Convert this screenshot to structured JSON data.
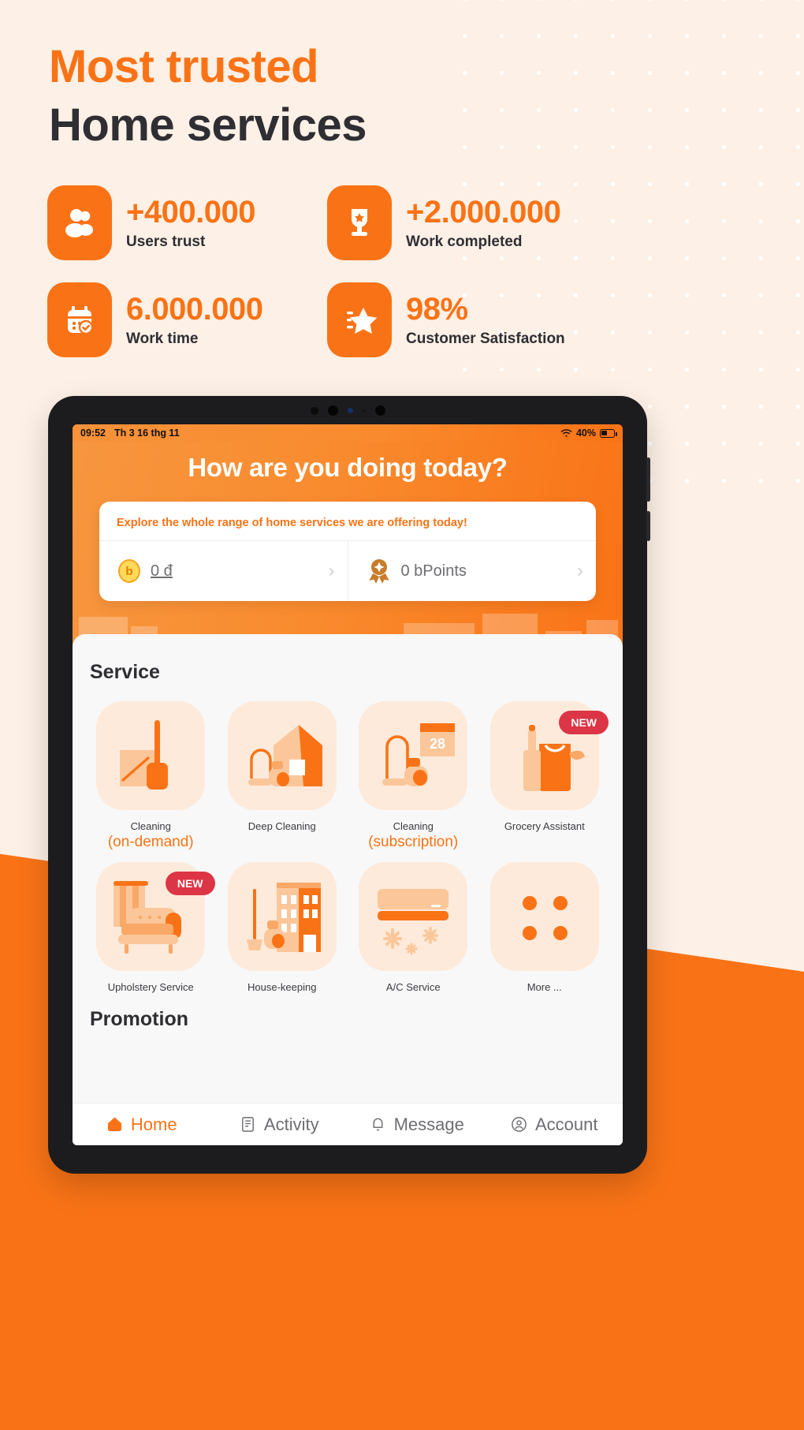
{
  "hero": {
    "title_line1": "Most trusted",
    "title_line2": "Home services"
  },
  "stats": [
    {
      "icon": "users-icon",
      "value": "+400.000",
      "label": "Users trust"
    },
    {
      "icon": "trophy-icon",
      "value": "+2.000.000",
      "label": "Work completed"
    },
    {
      "icon": "calendar-check-icon",
      "value": "6.000.000",
      "label": "Work time"
    },
    {
      "icon": "star-badge-icon",
      "value": "98%",
      "label": "Customer Satisfaction"
    }
  ],
  "device": {
    "statusbar": {
      "time": "09:52",
      "date": "Th 3 16 thg 11",
      "wifi_icon": "wifi-icon",
      "battery": "40%"
    }
  },
  "app": {
    "greeting": "How are you doing today?",
    "promo_note": "Explore the whole range of home services we are offering today!",
    "wallet": {
      "balance_icon": "bcoin-icon",
      "balance": "0 đ",
      "points_icon": "bpoints-medal-icon",
      "points": "0 bPoints",
      "chevron_icon": "chevron-right-icon"
    },
    "service_section_title": "Service",
    "promotion_section_title": "Promotion",
    "services": [
      {
        "label": "Cleaning",
        "sublabel": "(on-demand)",
        "icon": "mop-bucket-icon",
        "badge": ""
      },
      {
        "label": "Deep Cleaning",
        "sublabel": "",
        "icon": "house-vacuum-icon",
        "badge": ""
      },
      {
        "label": "Cleaning",
        "sublabel": "(subscription)",
        "icon": "vacuum-calendar-icon",
        "badge": "",
        "calendar_day": "28"
      },
      {
        "label": "Grocery Assistant",
        "sublabel": "",
        "icon": "grocery-bag-icon",
        "badge": "NEW"
      },
      {
        "label": "Upholstery Service",
        "sublabel": "",
        "icon": "sofa-icon",
        "badge": "NEW"
      },
      {
        "label": "House-keeping",
        "sublabel": "",
        "icon": "building-broom-icon",
        "badge": ""
      },
      {
        "label": "A/C Service",
        "sublabel": "",
        "icon": "air-conditioner-icon",
        "badge": ""
      },
      {
        "label": "More ...",
        "sublabel": "",
        "icon": "more-dots-icon",
        "badge": ""
      }
    ],
    "bottom_nav": [
      {
        "label": "Home",
        "icon": "home-icon",
        "active": true
      },
      {
        "label": "Activity",
        "icon": "activity-icon",
        "active": false
      },
      {
        "label": "Message",
        "icon": "bell-icon",
        "active": false
      },
      {
        "label": "Account",
        "icon": "account-icon",
        "active": false
      }
    ]
  },
  "colors": {
    "brand_orange": "#F97316",
    "cream_bg": "#FDF0E6",
    "tile_bg": "#FDEADB",
    "badge_red": "#DC3545",
    "dark_text": "#2E2E33"
  }
}
